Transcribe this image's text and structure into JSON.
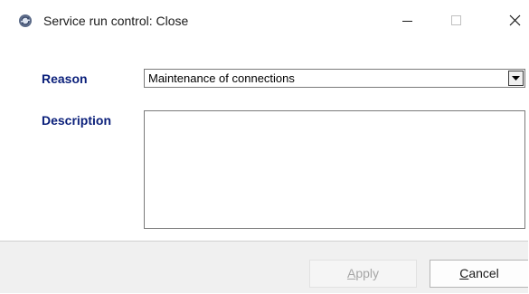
{
  "window": {
    "title": "Service run control: Close",
    "app_icon": "gear-icon",
    "controls": {
      "minimize": "minimize-icon",
      "maximize": "maximize-icon",
      "close": "close-icon"
    }
  },
  "form": {
    "reason_label": "Reason",
    "reason_value": "Maintenance of connections",
    "description_label": "Description",
    "description_value": ""
  },
  "buttons": {
    "apply_mnemonic": "A",
    "apply_rest": "pply",
    "apply_enabled": false,
    "cancel_mnemonic": "C",
    "cancel_rest": "ancel"
  },
  "colors": {
    "label_color": "#0a1f7a",
    "footer_bg": "#f0f0f0",
    "disabled_text": "#a6a6a6"
  }
}
